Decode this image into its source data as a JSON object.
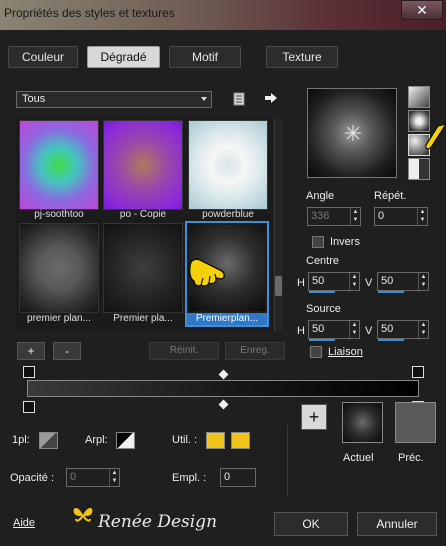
{
  "window": {
    "title": "Propriétés des styles et textures",
    "close_glyph": "✕"
  },
  "tabs": [
    {
      "label": "Couleur",
      "active": false
    },
    {
      "label": "Dégradé",
      "active": true
    },
    {
      "label": "Motif",
      "active": false
    },
    {
      "label": "Texture",
      "active": false
    }
  ],
  "category": {
    "selected": "Tous"
  },
  "library": {
    "items": [
      {
        "label": "pj-soothtoo"
      },
      {
        "label": "po - Copie"
      },
      {
        "label": "powderblue"
      },
      {
        "label": "premier plan..."
      },
      {
        "label": "Premier pla..."
      },
      {
        "label": "Premierplan...",
        "selected": true
      }
    ],
    "add_label": "+",
    "remove_label": "-",
    "reset_label": "Réinit.",
    "save_label": "Enreg."
  },
  "gradient": {
    "angle_label": "Angle",
    "angle_value": "336",
    "repeat_label": "Répét.",
    "repeat_value": "0",
    "invert_label": "Invers",
    "center_label": "Centre",
    "center_h_label": "H",
    "center_h": "50",
    "center_v_label": "V",
    "center_v": "50",
    "source_label": "Source",
    "source_h_label": "H",
    "source_h": "50",
    "source_v_label": "V",
    "source_v": "50",
    "link_label": "Liaison"
  },
  "stops": {
    "first_label": "1pl:",
    "backplane_label": "Arpl:",
    "user_label": "Util. :",
    "opacity_label": "Opacité :",
    "opacity_value": "0",
    "location_label": "Empl. :",
    "location_value": "0",
    "user_color": "#f0c419"
  },
  "compare": {
    "plus_label": "+",
    "current_label": "Actuel",
    "previous_label": "Préc."
  },
  "footer": {
    "help_label": "Aide",
    "watermark": "Renée Design",
    "ok_label": "OK",
    "cancel_label": "Annuler"
  },
  "colors": {
    "accent": "#3f8fd8",
    "pointer": "#f5d10a"
  },
  "icons": {
    "library-menu": "library-menu-icon",
    "apply-arrow": "arrow-right-icon",
    "pointer-hand": "pointing-hand-icon"
  }
}
